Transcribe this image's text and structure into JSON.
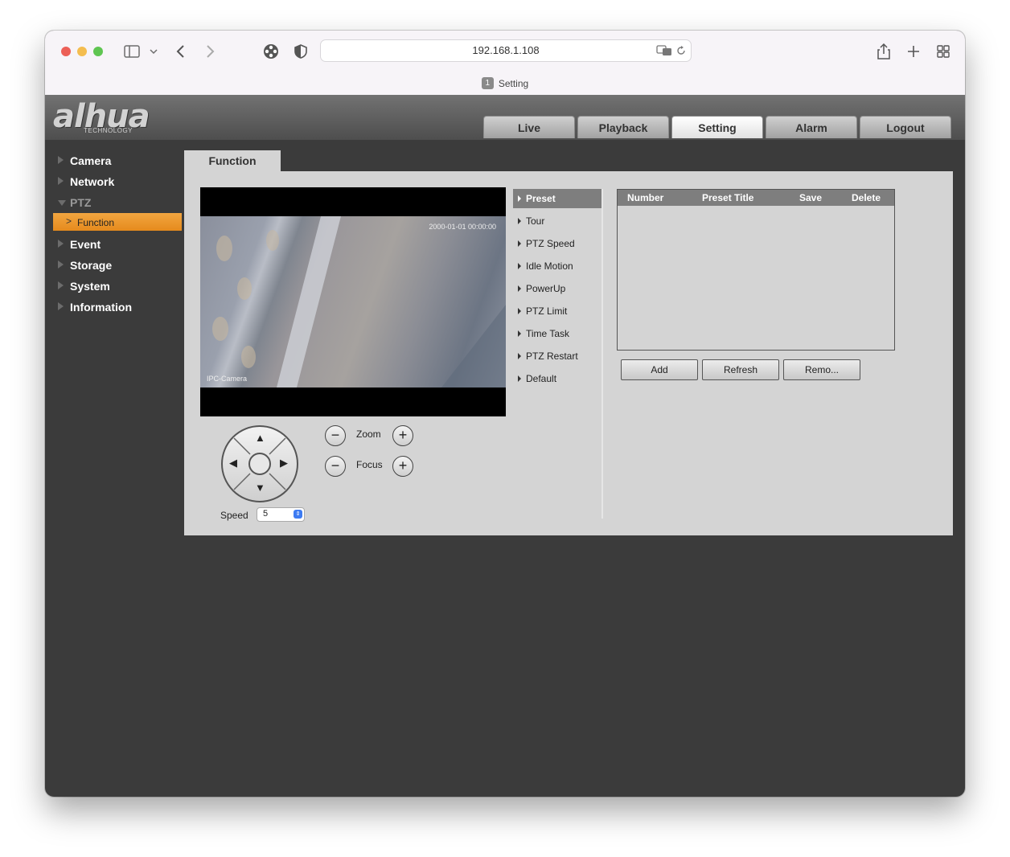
{
  "browser": {
    "url": "192.168.1.108",
    "tab_number": "1",
    "tab_title": "Setting"
  },
  "app": {
    "logo_text": "alhua",
    "logo_subtext": "TECHNOLOGY",
    "nav_tabs": [
      {
        "label": "Live",
        "active": false
      },
      {
        "label": "Playback",
        "active": false
      },
      {
        "label": "Setting",
        "active": true
      },
      {
        "label": "Alarm",
        "active": false
      },
      {
        "label": "Logout",
        "active": false
      }
    ]
  },
  "sidebar": {
    "items": [
      {
        "label": "Camera"
      },
      {
        "label": "Network"
      },
      {
        "label": "PTZ",
        "expanded": true
      },
      {
        "label": "Event"
      },
      {
        "label": "Storage"
      },
      {
        "label": "System"
      },
      {
        "label": "Information"
      }
    ],
    "sub_item": {
      "label": "Function",
      "selected": true
    }
  },
  "content": {
    "tab_label": "Function",
    "video": {
      "timestamp": "2000-01-01 00:00:00",
      "camera_name": "IPC-Camera"
    },
    "ptz": {
      "speed_label": "Speed",
      "speed_value": "5",
      "zoom_label": "Zoom",
      "focus_label": "Focus",
      "minus_symbol": "−",
      "plus_symbol": "+",
      "arrows": {
        "up": "▲",
        "down": "▼",
        "left": "◀",
        "right": "▶"
      }
    },
    "menu": [
      {
        "label": "Preset",
        "active": true
      },
      {
        "label": "Tour"
      },
      {
        "label": "PTZ Speed"
      },
      {
        "label": "Idle Motion"
      },
      {
        "label": "PowerUp"
      },
      {
        "label": "PTZ Limit"
      },
      {
        "label": "Time Task"
      },
      {
        "label": "PTZ Restart"
      },
      {
        "label": "Default"
      }
    ],
    "table": {
      "headers": [
        "Number",
        "Preset Title",
        "Save",
        "Delete"
      ],
      "rows": []
    },
    "buttons": {
      "add": "Add",
      "refresh": "Refresh",
      "remove": "Remo..."
    }
  },
  "colors": {
    "accent_orange": "#e58a1d",
    "header_gray": "#7e7e7e",
    "background_dark": "#3b3b3b",
    "panel_gray": "#d4d4d4"
  }
}
